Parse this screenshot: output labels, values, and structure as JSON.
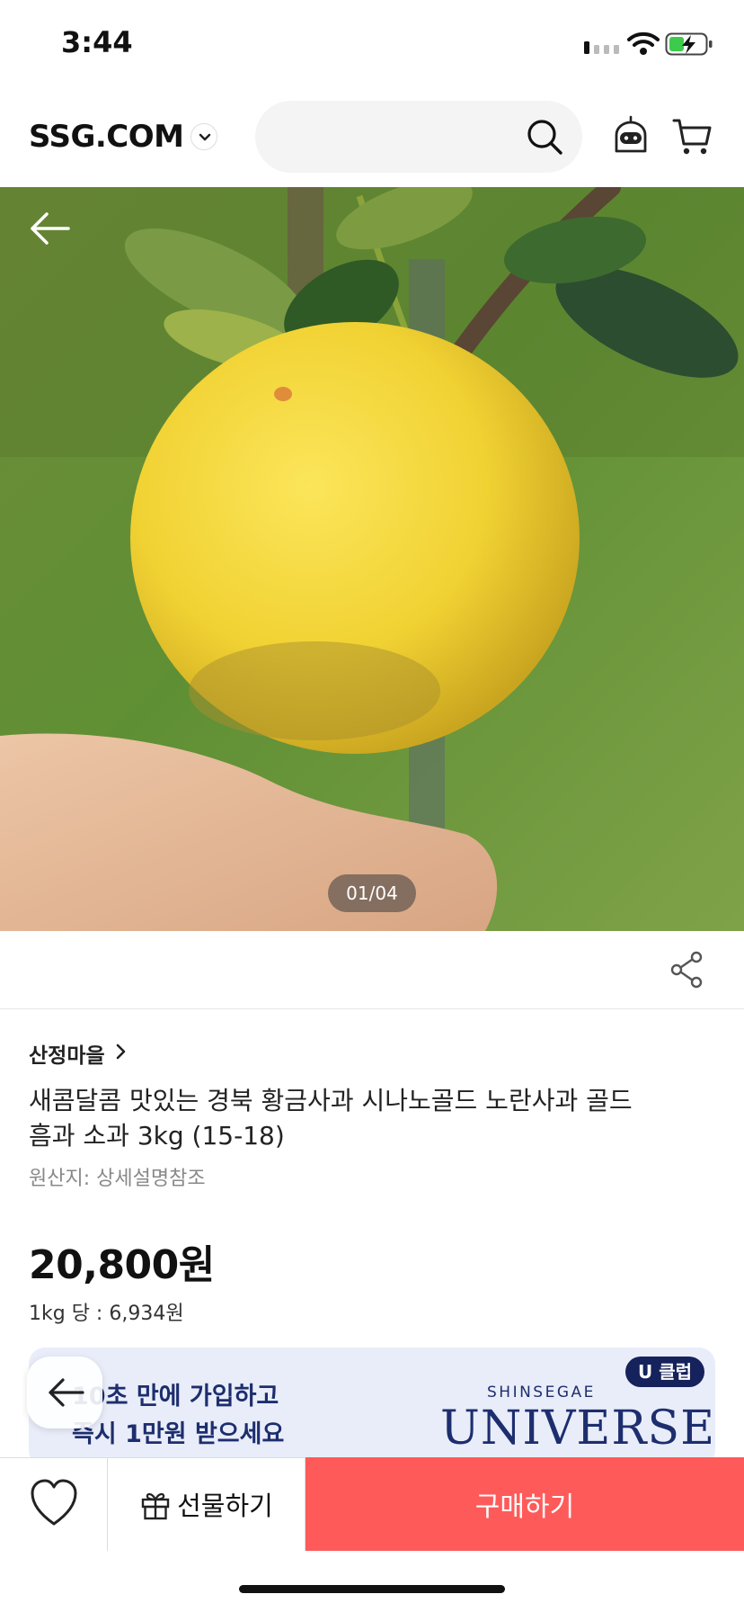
{
  "status_bar": {
    "time": "3:44"
  },
  "header": {
    "logo": "SSG.COM",
    "search_value": ""
  },
  "gallery": {
    "counter": "01/04"
  },
  "product": {
    "brand": "산정마을",
    "title": "새콤달콤 맛있는 경북 황금사과 시나노골드 노란사과 골드 흠과 소과 3kg (15-18)",
    "origin": "원산지: 상세설명참조",
    "price": "20,800원",
    "unit_price": "1kg 당 : 6,934원"
  },
  "banner": {
    "line1": "10초 만에 가입하고",
    "line2": "즉시 1만원 받으세요",
    "brand_sub": "SHINSEGAE",
    "brand_main": "UNIVERSE",
    "badge": "U 클럽"
  },
  "actions": {
    "gift": "선물하기",
    "buy": "구매하기"
  },
  "colors": {
    "buy_button": "#ff5a5a",
    "banner_bg": "#e9edf9",
    "banner_text": "#1d2e6e"
  }
}
